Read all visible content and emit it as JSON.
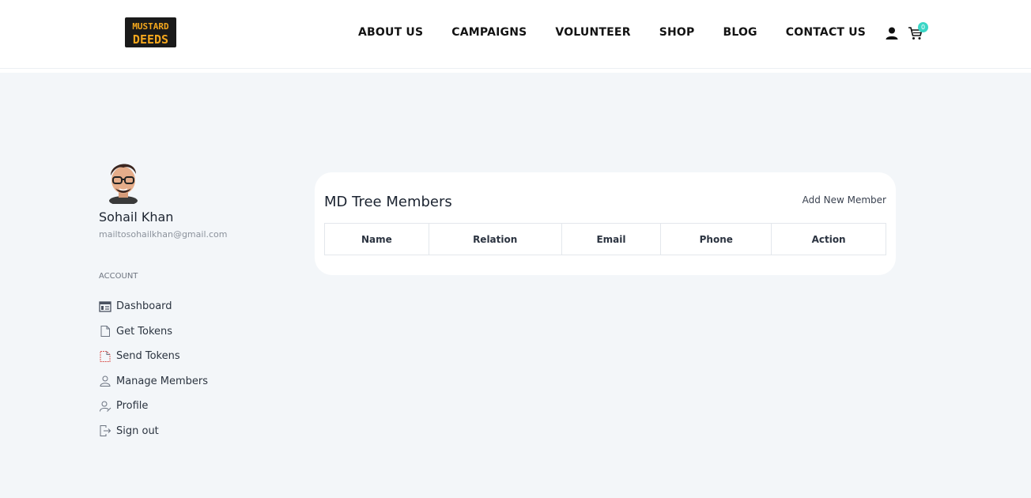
{
  "header": {
    "logo_text_top": "MUSTARD",
    "logo_text_bottom": "DEEDS",
    "nav": [
      "ABOUT US",
      "CAMPAIGNS",
      "VOLUNTEER",
      "SHOP",
      "BLOG",
      "CONTACT US"
    ],
    "cart_count": "0",
    "icons": [
      "user-icon",
      "cart-icon"
    ]
  },
  "profile": {
    "name": "Sohail Khan",
    "email": "mailtosohailkhan@gmail.com"
  },
  "sidebar": {
    "section_label": "ACCOUNT",
    "items": [
      {
        "label": "Dashboard",
        "icon": "dashboard-icon"
      },
      {
        "label": "Get Tokens",
        "icon": "document-icon"
      },
      {
        "label": "Send Tokens",
        "icon": "document-send-icon"
      },
      {
        "label": "Manage Members",
        "icon": "user-icon"
      },
      {
        "label": "Profile",
        "icon": "user-edit-icon"
      },
      {
        "label": "Sign out",
        "icon": "sign-out-icon"
      }
    ]
  },
  "main": {
    "title": "MD Tree Members",
    "add_label": "Add New Member",
    "columns": [
      "Name",
      "Relation",
      "Email",
      "Phone",
      "Action"
    ]
  },
  "colors": {
    "background": "#f3f6f9",
    "card": "#ffffff",
    "badge": "#3bd6c6",
    "logo_fill": "#f4a71d"
  }
}
